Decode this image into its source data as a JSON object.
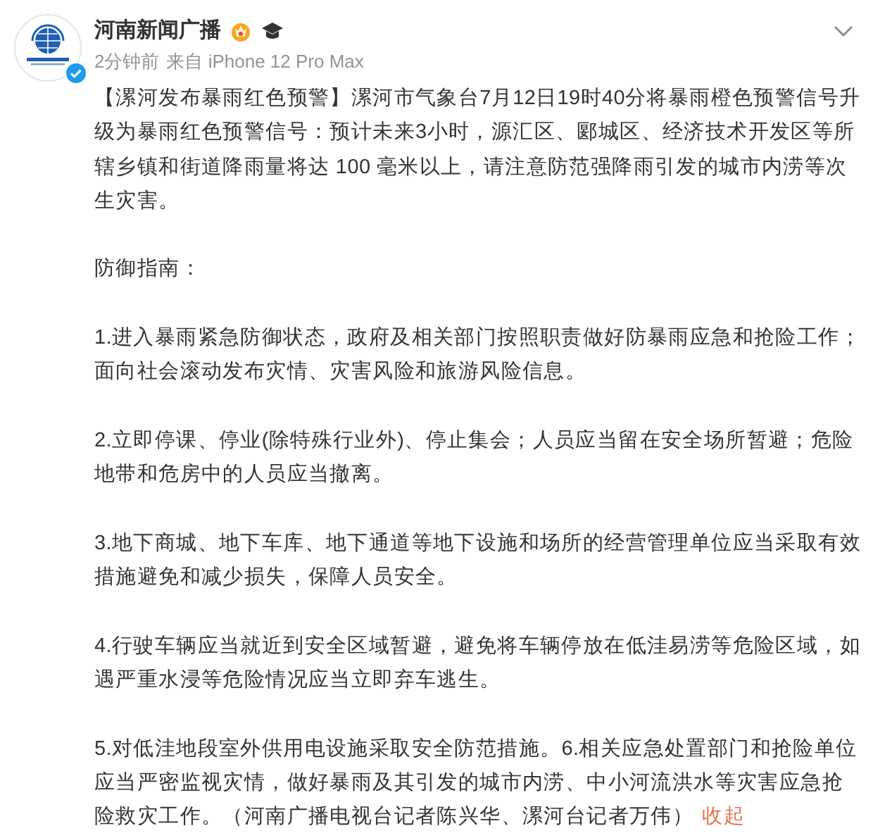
{
  "post": {
    "author": "河南新闻广播",
    "time": "2分钟前",
    "source": "来自 iPhone 12 Pro Max",
    "paragraphs": [
      "【漯河发布暴雨红色预警】漯河市气象台7月12日19时40分将暴雨橙色预警信号升级为暴雨红色预警信号：预计未来3小时，源汇区、郾城区、经济技术开发区等所辖乡镇和街道降雨量将达 100 毫米以上，请注意防范强降雨引发的城市内涝等次生灾害。",
      "防御指南：",
      "1.进入暴雨紧急防御状态，政府及相关部门按照职责做好防暴雨应急和抢险工作；面向社会滚动发布灾情、灾害风险和旅游风险信息。",
      "2.立即停课、停业(除特殊行业外)、停止集会；人员应当留在安全场所暂避；危险地带和危房中的人员应当撤离。",
      "3.地下商城、地下车库、地下通道等地下设施和场所的经营管理单位应当采取有效措施避免和减少损失，保障人员安全。",
      "4.行驶车辆应当就近到安全区域暂避，避免将车辆停放在低洼易涝等危险区域，如遇严重水浸等危险情况应当立即弃车逃生。",
      "5.对低洼地段室外供用电设施采取安全防范措施。6.相关应急处置部门和抢险单位应当严密监视灾情，做好暴雨及其引发的城市内涝、中小河流洪水等灾害应急抢险救灾工作。（河南广播电视台记者陈兴华、漯河台记者万伟）"
    ],
    "collapse_link": "收起",
    "verified": true
  }
}
